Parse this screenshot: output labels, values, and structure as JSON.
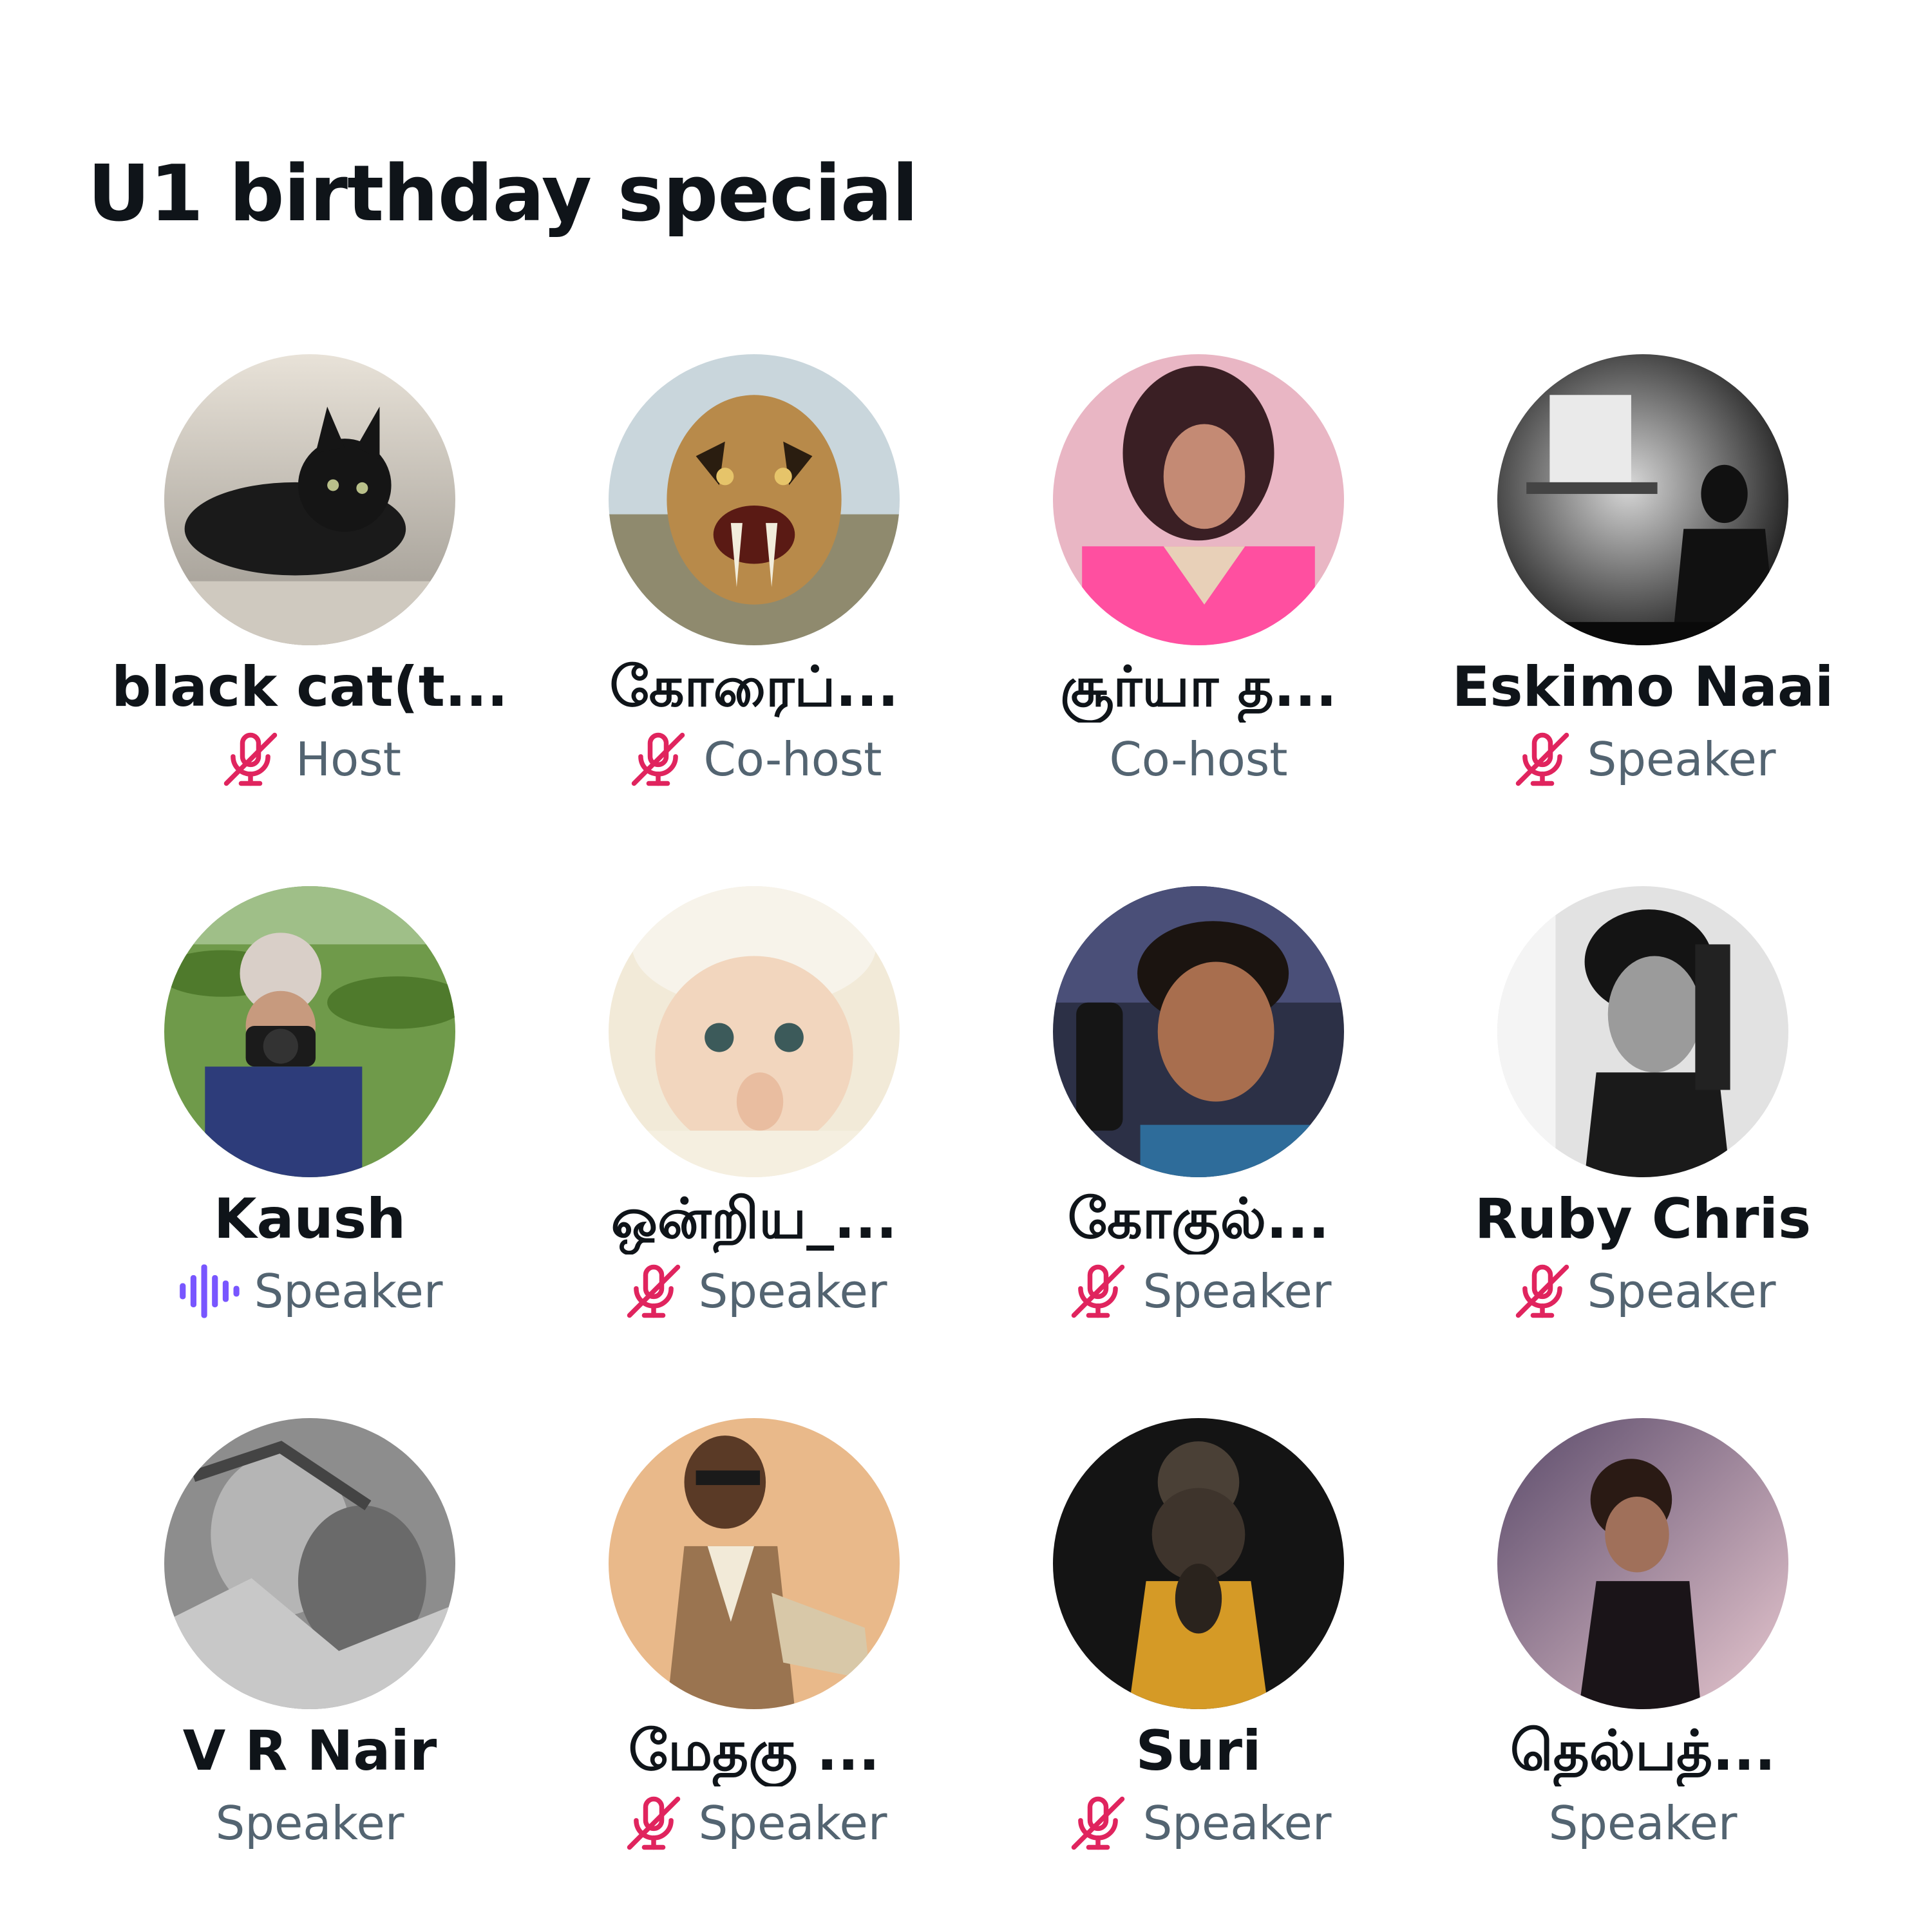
{
  "space": {
    "title": "U1 birthday special"
  },
  "colors": {
    "muted_icon": "#e0245e",
    "speaking_icon": "#7856ff",
    "role_text": "#536471",
    "name_text": "#0f1419"
  },
  "participants": [
    {
      "name": "black cat(t...",
      "role": "Host",
      "status_icon": "mic-muted-icon"
    },
    {
      "name": "கோரைப்...",
      "role": "Co-host",
      "status_icon": "mic-muted-icon"
    },
    {
      "name": "சூர்யா த...",
      "role": "Co-host",
      "status_icon": "none"
    },
    {
      "name": "Eskimo Naai",
      "role": "Speaker",
      "status_icon": "mic-muted-icon"
    },
    {
      "name": "Kaush",
      "role": "Speaker",
      "status_icon": "speaking-waveform-icon"
    },
    {
      "name": "ஒன்றிய_...",
      "role": "Speaker",
      "status_icon": "mic-muted-icon"
    },
    {
      "name": "கோகுல்...",
      "role": "Speaker",
      "status_icon": "mic-muted-icon"
    },
    {
      "name": "Ruby Chris",
      "role": "Speaker",
      "status_icon": "mic-muted-icon"
    },
    {
      "name": "V R Nair",
      "role": "Speaker",
      "status_icon": "none"
    },
    {
      "name": "மேதகு ...",
      "role": "Speaker",
      "status_icon": "mic-muted-icon"
    },
    {
      "name": "Suri",
      "role": "Speaker",
      "status_icon": "mic-muted-icon"
    },
    {
      "name": "தெல்பத்...",
      "role": "Speaker",
      "status_icon": "none"
    }
  ]
}
